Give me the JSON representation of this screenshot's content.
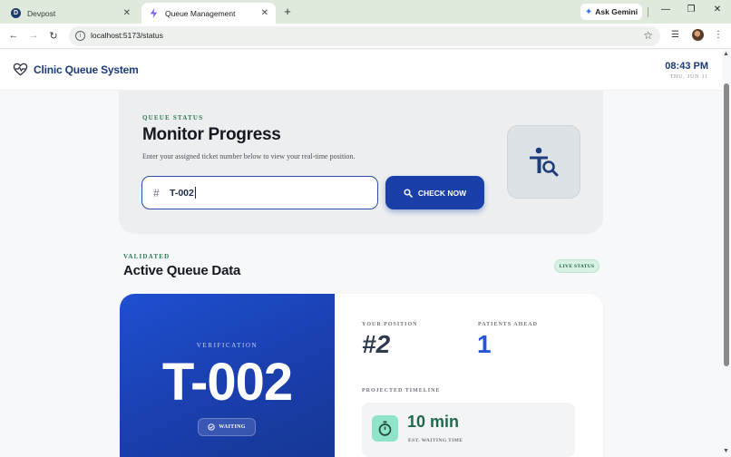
{
  "browser": {
    "tabs": [
      {
        "title": "Devpost",
        "favicon": "D"
      },
      {
        "title": "Queue Management"
      }
    ],
    "gemini_label": "Ask Gemini",
    "url": "localhost:5173/status"
  },
  "header": {
    "brand": "Clinic Queue System",
    "time": "08:43 PM",
    "date": "THU, JUN 11"
  },
  "status_card": {
    "eyebrow": "QUEUE STATUS",
    "title": "Monitor Progress",
    "description": "Enter your assigned ticket number below to view your real-time position.",
    "input_prefix": "#",
    "input_value": "T-002",
    "button_label": "CHECK NOW"
  },
  "queue_data": {
    "eyebrow": "VALIDATED",
    "title": "Active Queue Data",
    "badge": "LIVE STATUS",
    "ticket_label": "VERIFICATION",
    "ticket_number": "T-002",
    "ticket_status": "WAITING",
    "position_label": "YOUR POSITION",
    "position_value": "#2",
    "ahead_label": "PATIENTS AHEAD",
    "ahead_value": "1",
    "timeline_label": "PROJECTED TIMELINE",
    "wait_value": "10 min",
    "wait_label": "EST. WAITING TIME"
  },
  "colors": {
    "brand_blue": "#1d3b7a",
    "primary_button": "#1b3fa8",
    "accent_green": "#2f7a55",
    "ticket_panel": "#1f4fd1",
    "ahead_blue": "#2457d6",
    "timer_mint": "#8fe3c8"
  }
}
